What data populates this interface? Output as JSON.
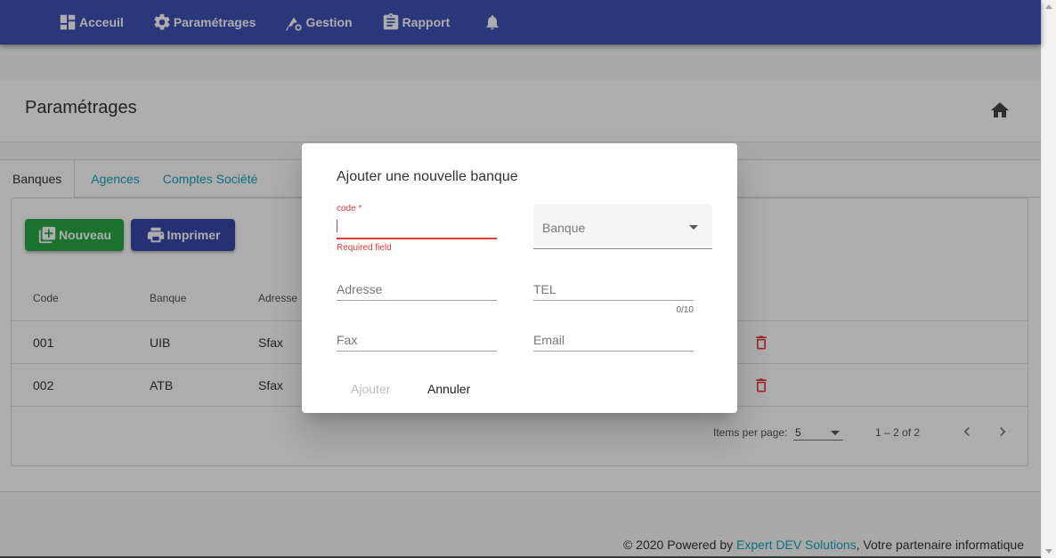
{
  "nav": {
    "items": [
      {
        "label": "Acceuil",
        "icon": "dashboard-icon"
      },
      {
        "label": "Paramétrages",
        "icon": "gear-icon"
      },
      {
        "label": "Gestion",
        "icon": "gestion-icon"
      },
      {
        "label": "Rapport",
        "icon": "clipboard-icon"
      }
    ],
    "bell_icon": "bell-icon",
    "color": "#3f51b5"
  },
  "page": {
    "title": "Paramétrages",
    "home_icon": "home-icon"
  },
  "tabs": [
    {
      "label": "Banques",
      "active": true
    },
    {
      "label": "Agences",
      "active": false
    },
    {
      "label": "Comptes Société",
      "active": false
    }
  ],
  "toolbar": {
    "new_label": "Nouveau",
    "print_label": "Imprimer"
  },
  "table": {
    "headers": {
      "code": "Code",
      "banque": "Banque",
      "adresse": "Adresse"
    },
    "rows": [
      {
        "code": "001",
        "banque": "UIB",
        "adresse": "Sfax"
      },
      {
        "code": "002",
        "banque": "ATB",
        "adresse": "Sfax"
      }
    ]
  },
  "paginator": {
    "items_per_page_label": "Items per page:",
    "page_size": "5",
    "range": "1 – 2 of 2"
  },
  "footer": {
    "prefix": "© 2020 Powered by ",
    "link": "Expert DEV Solutions",
    "suffix": ", Votre partenaire informatique"
  },
  "dialog": {
    "title": "Ajouter une nouvelle banque",
    "code_label": "code *",
    "code_error": "Required field",
    "banque_placeholder": "Banque",
    "adresse_placeholder": "Adresse",
    "tel_placeholder": "TEL",
    "tel_hint": "0/10",
    "fax_placeholder": "Fax",
    "email_placeholder": "Email",
    "ajouter_label": "Ajouter",
    "annuler_label": "Annuler"
  },
  "colors": {
    "primary": "#3f51b5",
    "success": "#28a745",
    "accent": "#3949ab",
    "link": "#17a2b8",
    "error": "#e53935"
  }
}
